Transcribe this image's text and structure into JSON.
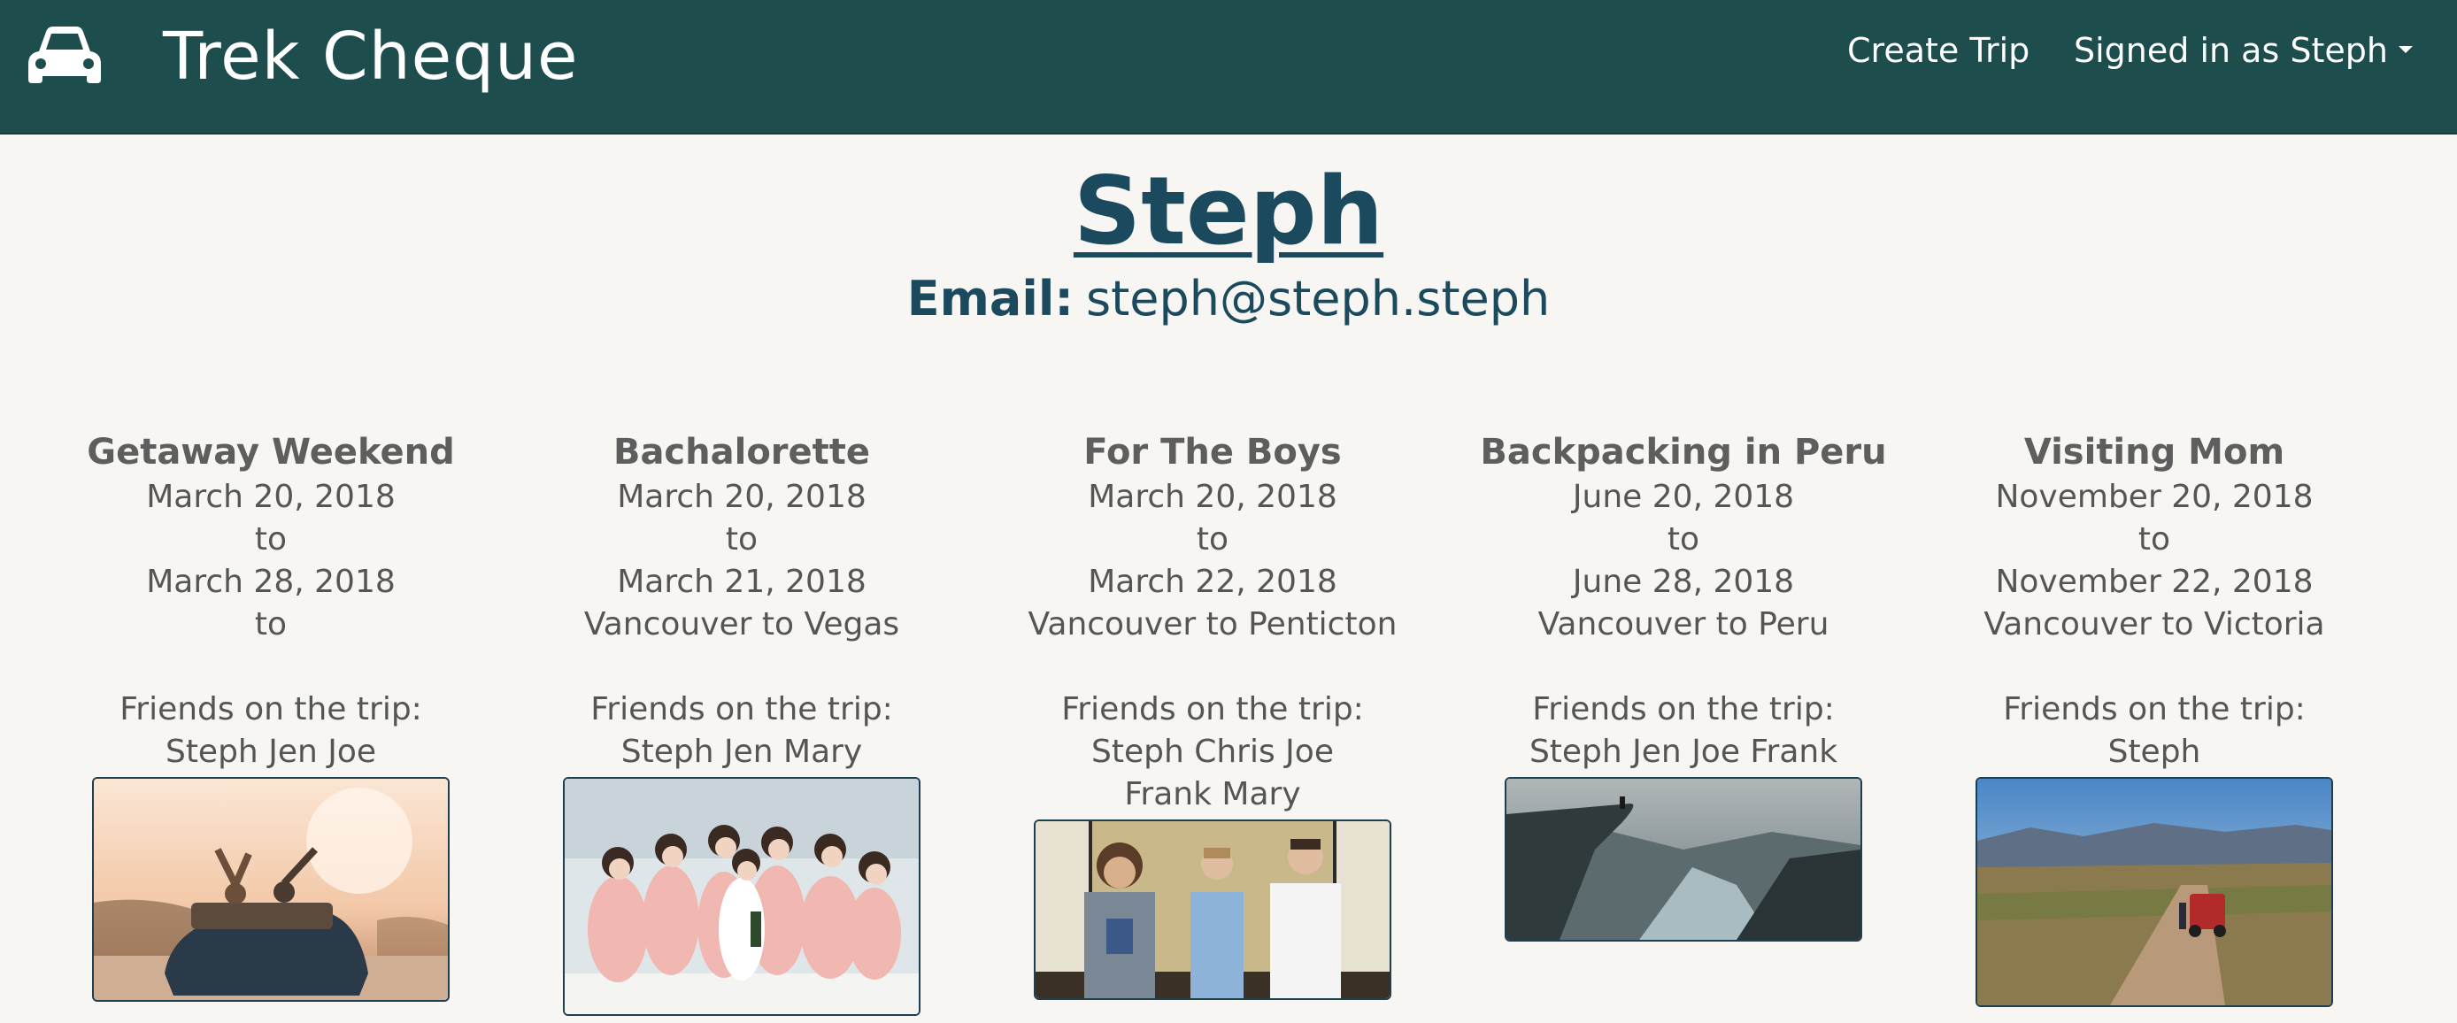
{
  "navbar": {
    "brand_icon": "car-icon",
    "brand": "Trek Cheque",
    "create_trip": "Create Trip",
    "signed_in": "Signed in as Steph",
    "dropdown_icon": "caret-down-icon",
    "background_color": "#1e4d4d"
  },
  "profile": {
    "name": "Steph",
    "email_label": "Email:",
    "email": "steph@steph.steph",
    "name_color": "#1b4a5e"
  },
  "trips": [
    {
      "title": "Getaway Weekend",
      "start": "March 20, 2018",
      "to1": "to",
      "end": "March 28, 2018",
      "route": "to",
      "friends_label": "Friends on the trip:",
      "friends": "Steph Jen Joe",
      "photo": "convertible-sunset-photo"
    },
    {
      "title": "Bachalorette",
      "start": "March 20, 2018",
      "to1": "to",
      "end": "March 21, 2018",
      "route": "Vancouver to Vegas",
      "friends_label": "Friends on the trip:",
      "friends": "Steph Jen Mary",
      "photo": "bridal-party-photo"
    },
    {
      "title": "For The Boys",
      "start": "March 20, 2018",
      "to1": "to",
      "end": "March 22, 2018",
      "route": "Vancouver to Penticton",
      "friends_label": "Friends on the trip:",
      "friends": "Steph Chris Joe Frank Mary",
      "photo": "three-men-elevator-photo"
    },
    {
      "title": "Backpacking in Peru",
      "start": "June 20, 2018",
      "to1": "to",
      "end": "June 28, 2018",
      "route": "Vancouver to Peru",
      "friends_label": "Friends on the trip:",
      "friends": "Steph Jen Joe Frank",
      "photo": "cliff-fjord-photo"
    },
    {
      "title": "Visiting Mom",
      "start": "November 20, 2018",
      "to1": "to",
      "end": "November 22, 2018",
      "route": "Vancouver to Victoria",
      "friends_label": "Friends on the trip:",
      "friends": "Steph",
      "photo": "jeep-dirt-road-photo"
    }
  ]
}
